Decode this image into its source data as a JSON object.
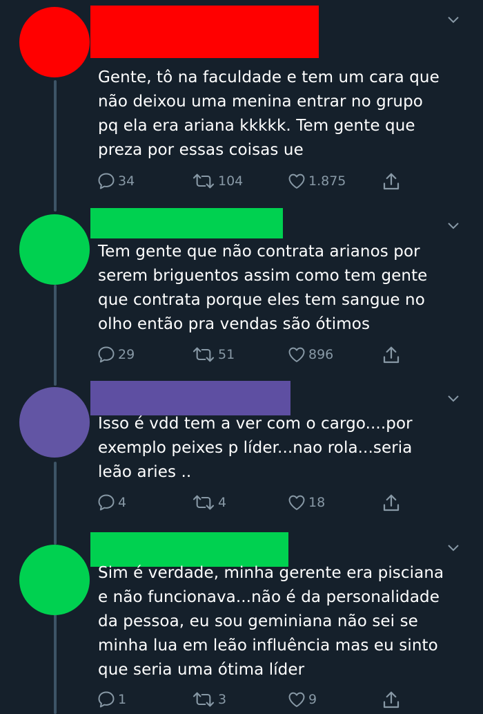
{
  "colors": {
    "background": "#15202b",
    "text": "#ffffff",
    "muted": "#8899a6",
    "thread_line": "#3d5466"
  },
  "tweets": [
    {
      "avatar_color": "#ff0000",
      "name_color": "#ff0000",
      "text": "Gente, tô na faculdade e tem um cara que\nnão deixou uma menina entrar no grupo\npq ela era ariana kkkkk. Tem gente que\npreza por essas coisas ue",
      "replies": "34",
      "retweets": "104",
      "likes": "1.875"
    },
    {
      "avatar_color": "#00d150",
      "name_color": "#00d150",
      "text": "Tem gente que não contrata arianos por\nserem briguentos assim como tem gente\nque contrata porque eles tem sangue no\nolho então pra vendas são ótimos",
      "replies": "29",
      "retweets": "51",
      "likes": "896"
    },
    {
      "avatar_color": "#6255a4",
      "name_color": "#5e4fa2",
      "text": "Isso é vdd tem a ver com o cargo....por\nexemplo peixes p líder...nao rola...seria\nleão aries ..",
      "replies": "4",
      "retweets": "4",
      "likes": "18"
    },
    {
      "avatar_color": "#00d150",
      "name_color": "#00d150",
      "text": "Sim é verdade, minha gerente era pisciana\ne não funcionava...não é da personalidade\nda pessoa, eu sou geminiana não sei se\nminha lua em leão influência mas eu sinto\nque seria uma ótima líder",
      "replies": "1",
      "retweets": "3",
      "likes": "9"
    }
  ]
}
